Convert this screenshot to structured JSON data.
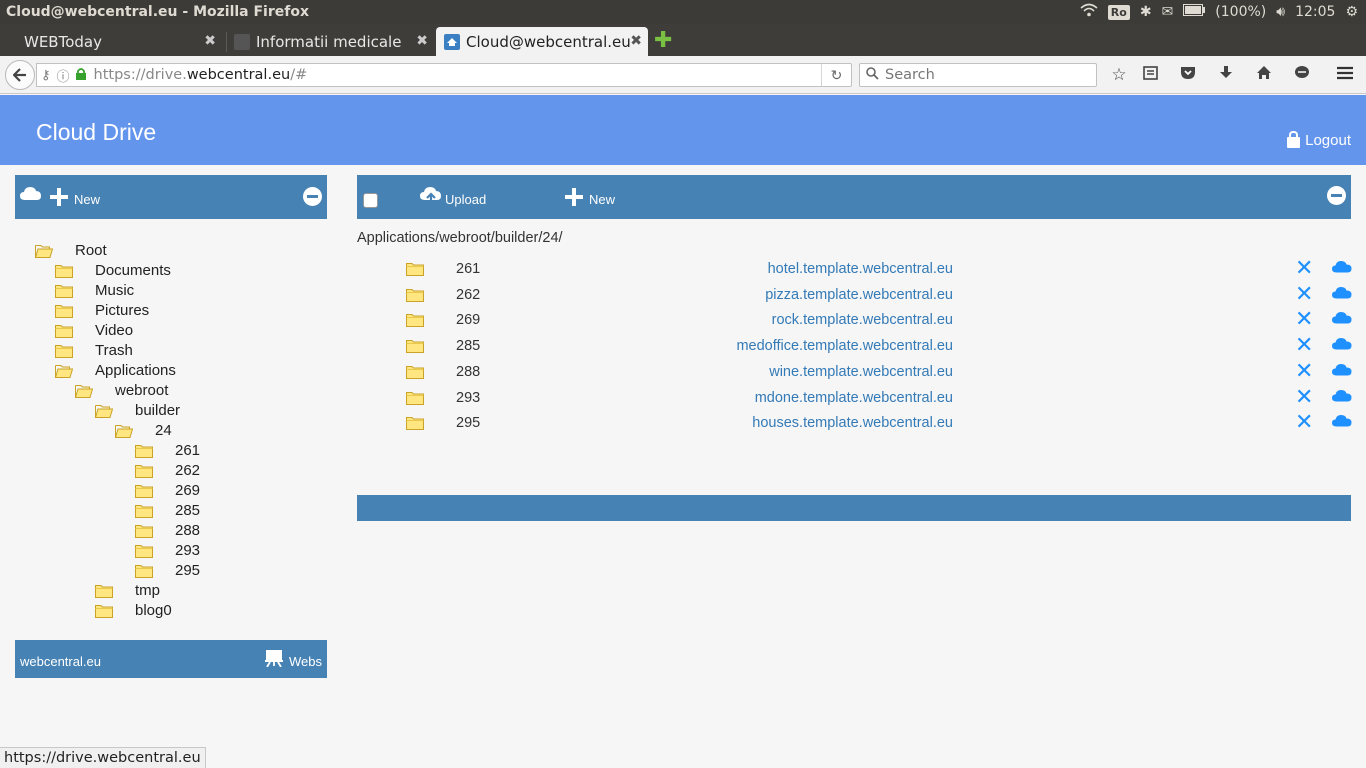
{
  "os": {
    "window_title": "Cloud@webcentral.eu - Mozilla Firefox",
    "keyboard": "Ro",
    "battery": "(100%)",
    "clock": "12:05"
  },
  "browser": {
    "tabs": [
      {
        "label": "WEBToday"
      },
      {
        "label": "Informatii medicale"
      },
      {
        "label": "Cloud@webcentral.eu"
      }
    ],
    "url_prefix": "https://drive.",
    "url_domain": "webcentral.eu",
    "url_suffix": "/#",
    "search_placeholder": "Search",
    "status_url": "https://drive.webcentral.eu"
  },
  "app": {
    "title": "Cloud Drive",
    "logout_label": "Logout"
  },
  "sidebar": {
    "new_label": "New",
    "tree": [
      {
        "label": "Root",
        "open": true
      },
      {
        "label": "Documents",
        "open": false
      },
      {
        "label": "Music",
        "open": false
      },
      {
        "label": "Pictures",
        "open": false
      },
      {
        "label": "Video",
        "open": false
      },
      {
        "label": "Trash",
        "open": false
      },
      {
        "label": "Applications",
        "open": true
      },
      {
        "label": "webroot",
        "open": true
      },
      {
        "label": "builder",
        "open": true
      },
      {
        "label": "24",
        "open": true
      },
      {
        "label": "261",
        "open": false
      },
      {
        "label": "262",
        "open": false
      },
      {
        "label": "269",
        "open": false
      },
      {
        "label": "285",
        "open": false
      },
      {
        "label": "288",
        "open": false
      },
      {
        "label": "293",
        "open": false
      },
      {
        "label": "295",
        "open": false
      },
      {
        "label": "tmp",
        "open": false
      },
      {
        "label": "blog0",
        "open": false
      }
    ],
    "footer_left": "webcentral.eu",
    "footer_right": "Webs"
  },
  "main": {
    "upload_label": "Upload",
    "new_label": "New",
    "breadcrumb": "Applications/webroot/builder/24/",
    "files": [
      {
        "name": "261",
        "link": "hotel.template.webcentral.eu"
      },
      {
        "name": "262",
        "link": "pizza.template.webcentral.eu"
      },
      {
        "name": "269",
        "link": "rock.template.webcentral.eu"
      },
      {
        "name": "285",
        "link": "medoffice.template.webcentral.eu"
      },
      {
        "name": "288",
        "link": "wine.template.webcentral.eu"
      },
      {
        "name": "293",
        "link": "mdone.template.webcentral.eu"
      },
      {
        "name": "295",
        "link": "houses.template.webcentral.eu"
      }
    ]
  },
  "colors": {
    "header": "#6495ed",
    "bar": "#4682b4",
    "link": "#337ab7",
    "delete": "#1e90ff"
  }
}
